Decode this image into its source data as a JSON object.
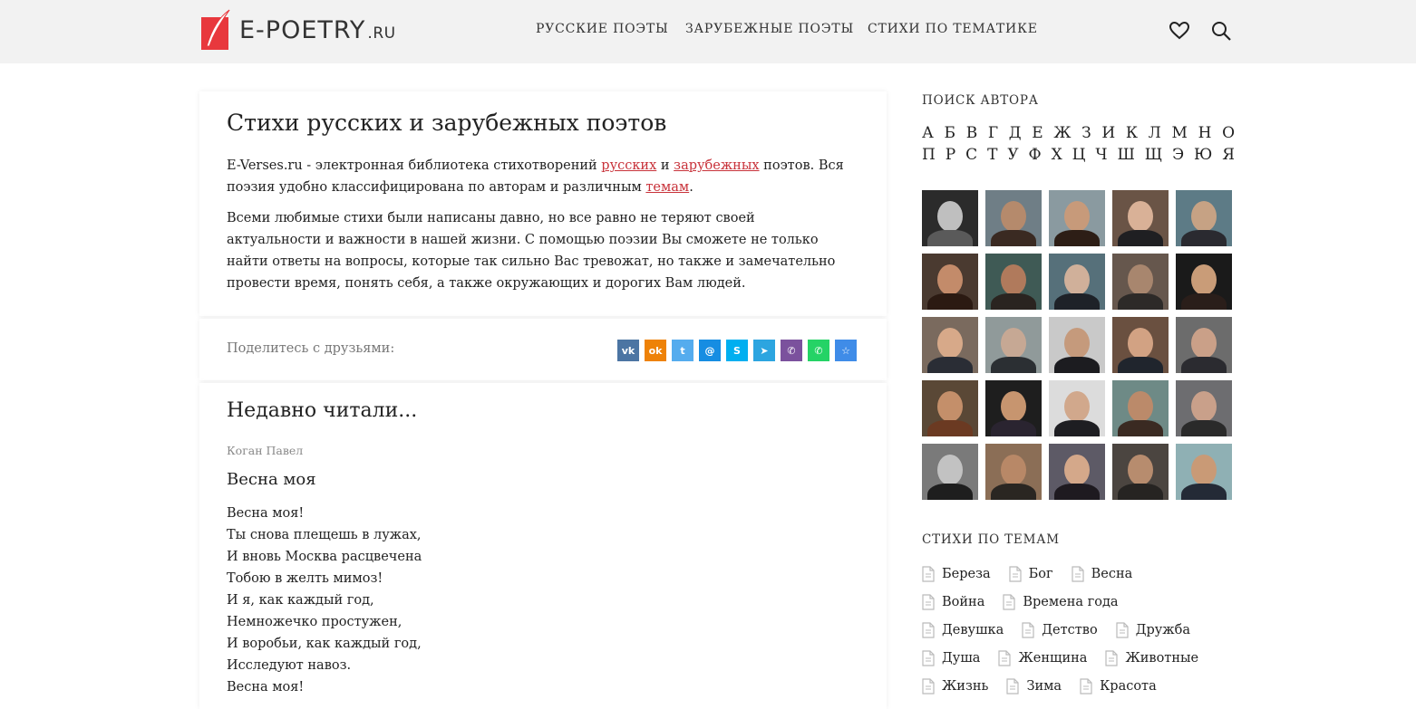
{
  "header": {
    "logo_main": "E-POETRY",
    "logo_tld": ".RU",
    "nav": [
      "РУССКИЕ ПОЭТЫ",
      "ЗАРУБЕЖНЫЕ ПОЭТЫ",
      "СТИХИ ПО ТЕМАТИКЕ"
    ],
    "icons": [
      "heart-icon",
      "search-icon"
    ]
  },
  "intro": {
    "title": "Стихи русских и зарубежных поэтов",
    "p1_a": "E-Verses.ru - электронная библиотека стихотворений ",
    "p1_link1": "русских",
    "p1_b": " и ",
    "p1_link2": "зарубежных",
    "p1_c": " поэтов. Вся поэзия удобно классифицирована по авторам и различным ",
    "p1_link3": "темам",
    "p1_d": ".",
    "p2": "Всеми любимые стихи были написаны давно, но все равно не теряют своей актуальности и важности в нашей жизни. С помощью поэзии Вы сможете не только найти ответы на вопросы, которые так сильно Вас тревожат, но также и замечательно провести время, понять себя, а также окружающих и дорогих Вам людей."
  },
  "share": {
    "label": "Поделитесь с друзьями:",
    "buttons": [
      {
        "name": "vk",
        "glyph": "vk",
        "color": "#4c75a3"
      },
      {
        "name": "odnoklassniki",
        "glyph": "ok",
        "color": "#ee8208"
      },
      {
        "name": "twitter",
        "glyph": "t",
        "color": "#55acee"
      },
      {
        "name": "mailru",
        "glyph": "@",
        "color": "#168de2"
      },
      {
        "name": "skype",
        "glyph": "S",
        "color": "#00aff0"
      },
      {
        "name": "telegram",
        "glyph": "➤",
        "color": "#2ca5e0"
      },
      {
        "name": "viber",
        "glyph": "✆",
        "color": "#7b519d"
      },
      {
        "name": "whatsapp",
        "glyph": "✆",
        "color": "#25d366"
      },
      {
        "name": "favorites",
        "glyph": "☆",
        "color": "#3f8ce8"
      }
    ]
  },
  "recent": {
    "title": "Недавно читали...",
    "author": "Коган Павел",
    "poem_title": "Весна моя",
    "lines": [
      "Весна моя!",
      "Ты снова плещешь в лужах,",
      "И вновь Москва расцвечена",
      "Тобою в желть мимоз!",
      "И я, как каждый год,",
      "Немножечко простужен,",
      "И воробьи, как каждый год,",
      "Исследуют навоз.",
      "Весна моя!"
    ]
  },
  "sidebar": {
    "search_title": "ПОИСК АВТОРА",
    "alphabet_row1": [
      "А",
      "Б",
      "В",
      "Г",
      "Д",
      "Е",
      "Ж",
      "З",
      "И",
      "К",
      "Л",
      "М",
      "Н",
      "О"
    ],
    "alphabet_row2": [
      "П",
      "Р",
      "С",
      "Т",
      "У",
      "Ф",
      "Х",
      "Ц",
      "Ч",
      "Ш",
      "Щ",
      "Э",
      "Ю",
      "Я"
    ],
    "topics_title": "СТИХИ ПО ТЕМАМ",
    "topic_rows": [
      [
        "Береза",
        "Бог",
        "Весна"
      ],
      [
        "Война",
        "Времена года"
      ],
      [
        "Девушка",
        "Детство",
        "Дружба"
      ],
      [
        "Душа",
        "Женщина",
        "Животные"
      ],
      [
        "Жизнь",
        "Зима",
        "Красота"
      ]
    ]
  },
  "colors": {
    "link": "#c8323a",
    "header_bg": "#f2f2f2",
    "logo_red": "#e8383d"
  }
}
